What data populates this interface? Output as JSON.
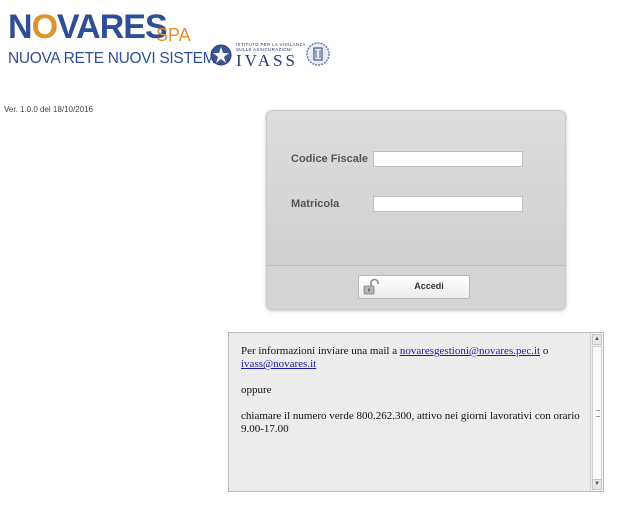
{
  "header": {
    "brand_prefix": "N",
    "brand_o": "O",
    "brand_rest": "VARES",
    "brand_suffix": "SPA",
    "brand_tagline": "NUOVA RETE NUOVI SISTEMI",
    "partner_small_1": "ISTITUTO PER LA VIGILANZA",
    "partner_small_2": "SULLE ASSICURAZIONI",
    "partner_name": "IVASS"
  },
  "version": "Ver. 1.0.0 del 18/10/2016",
  "login": {
    "codice_fiscale_label": "Codice Fiscale",
    "codice_fiscale_value": "",
    "matricola_label": "Matricola",
    "matricola_value": "",
    "submit_label": "Accedi"
  },
  "info": {
    "line1_prefix": "Per informazioni inviare una mail a ",
    "email1": "novaresgestioni@novares.pec.it",
    "line1_mid": " o",
    "email2": "ivass@novares.it",
    "oppure": "oppure",
    "phone_text": "chiamare il numero verde 800.262.300, attivo nei giorni lavorativi con orario 9.00-17.00"
  },
  "colors": {
    "brand_blue": "#2f4f95",
    "brand_orange": "#e58e2d",
    "link": "#1a1aa6"
  }
}
